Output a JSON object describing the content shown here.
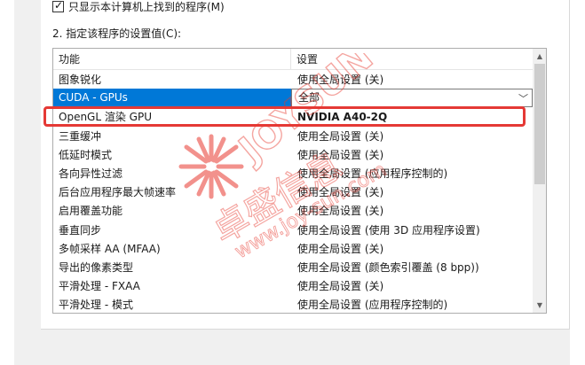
{
  "options": {
    "checkbox_label": "只显示本计算机上找到的程序(M)",
    "checkbox_checked": true,
    "section_label": "2. 指定该程序的设置值(C):"
  },
  "table": {
    "columns": [
      "功能",
      "设置"
    ],
    "rows": [
      {
        "feature": "图象锐化",
        "value": "使用全局设置 (关)"
      },
      {
        "feature": "CUDA - GPUs",
        "value": "全部"
      },
      {
        "feature": "OpenGL 渲染 GPU",
        "value": "NVIDIA A40-2Q"
      },
      {
        "feature": "三重缓冲",
        "value": "使用全局设置 (关)"
      },
      {
        "feature": "低延时模式",
        "value": "使用全局设置 (关)"
      },
      {
        "feature": "各向异性过滤",
        "value": "使用全局设置 (应用程序控制的)"
      },
      {
        "feature": "后台应用程序最大帧速率",
        "value": "使用全局设置 (关)"
      },
      {
        "feature": "启用覆盖功能",
        "value": "使用全局设置 (关)"
      },
      {
        "feature": "垂直同步",
        "value": "使用全局设置 (使用 3D 应用程序设置)"
      },
      {
        "feature": "多帧采样 AA (MFAA)",
        "value": "使用全局设置 (关)"
      },
      {
        "feature": "导出的像素类型",
        "value": "使用全局设置 (颜色索引覆盖 (8 bpp))"
      },
      {
        "feature": "平滑处理 - FXAA",
        "value": "使用全局设置 (关)"
      },
      {
        "feature": "平滑处理 - 模式",
        "value": "使用全局设置 (应用程序控制的)"
      }
    ]
  },
  "watermark": {
    "brand_latin": "JOYSUN",
    "brand_cn": "卓盛信息",
    "url": "www.joy-sun.com",
    "color": "#e8392f"
  },
  "colors": {
    "selection": "#0078d7",
    "highlight_border": "#e53935"
  }
}
